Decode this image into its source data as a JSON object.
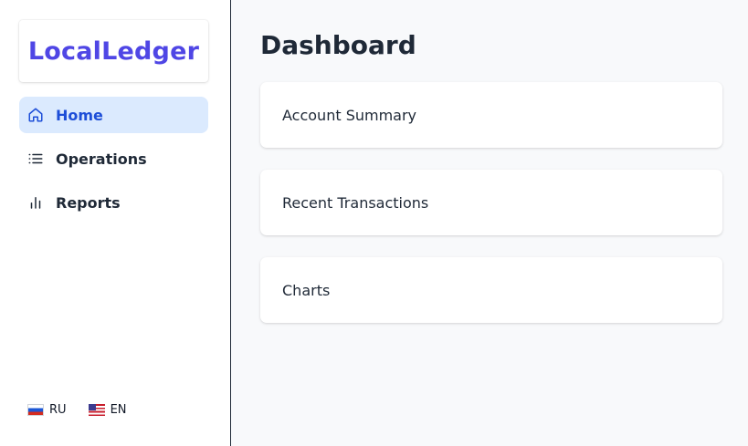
{
  "app": {
    "logo": "LocalLedger"
  },
  "sidebar": {
    "items": [
      {
        "label": "Home",
        "icon": "home-icon",
        "active": true
      },
      {
        "label": "Operations",
        "icon": "list-icon",
        "active": false
      },
      {
        "label": "Reports",
        "icon": "bar-chart-icon",
        "active": false
      }
    ],
    "languages": [
      {
        "code": "RU",
        "flag": "russia-flag-icon"
      },
      {
        "code": "EN",
        "flag": "us-flag-icon"
      }
    ]
  },
  "main": {
    "title": "Dashboard",
    "cards": [
      {
        "title": "Account Summary"
      },
      {
        "title": "Recent Transactions"
      },
      {
        "title": "Charts"
      }
    ]
  },
  "colors": {
    "brand": "#4f46e5",
    "active_bg": "#dbeafe",
    "active_text": "#1d4ed8"
  }
}
